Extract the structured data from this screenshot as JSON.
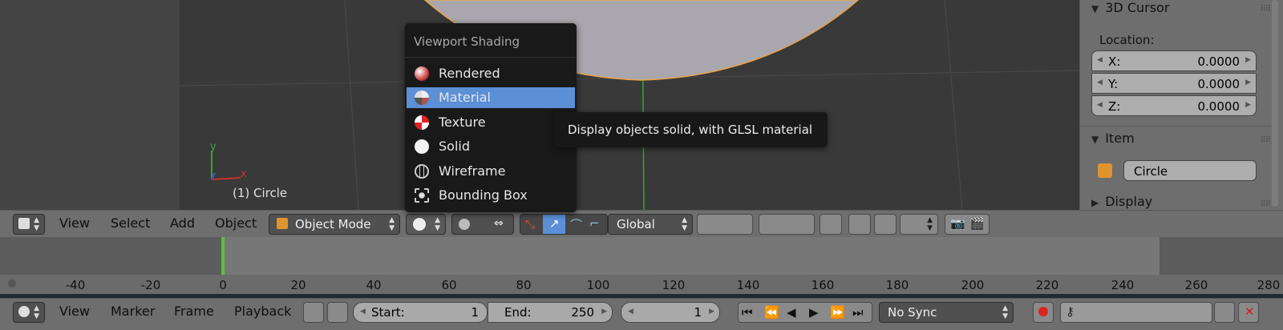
{
  "viewport": {
    "object_label": "(1) Circle",
    "axis_y": "y",
    "axis_x": "x"
  },
  "shading_menu": {
    "title": "Viewport Shading",
    "items": [
      {
        "label": "Rendered",
        "icon": "rendered-sphere-icon"
      },
      {
        "label": "Material",
        "icon": "material-sphere-icon",
        "selected": true
      },
      {
        "label": "Texture",
        "icon": "texture-sphere-icon"
      },
      {
        "label": "Solid",
        "icon": "solid-sphere-icon"
      },
      {
        "label": "Wireframe",
        "icon": "wireframe-sphere-icon"
      },
      {
        "label": "Bounding Box",
        "icon": "bounding-box-icon"
      }
    ],
    "tooltip": "Display objects solid, with GLSL material"
  },
  "properties_panel": {
    "cursor_title": "3D Cursor",
    "location_label": "Location:",
    "fields": [
      {
        "label": "X:",
        "value": "0.0000"
      },
      {
        "label": "Y:",
        "value": "0.0000"
      },
      {
        "label": "Z:",
        "value": "0.0000"
      }
    ],
    "item_title": "Item",
    "item_name": "Circle",
    "display_title": "Display"
  },
  "view3d_header": {
    "menus": [
      "View",
      "Select",
      "Add",
      "Object"
    ],
    "mode": "Object Mode",
    "orientation": "Global"
  },
  "timeline": {
    "ticks": [
      "-40",
      "-20",
      "0",
      "20",
      "40",
      "60",
      "80",
      "100",
      "120",
      "140",
      "160",
      "180",
      "200",
      "220",
      "240",
      "260",
      "280"
    ],
    "current_frame_marker": "0"
  },
  "timeline_header": {
    "menus": [
      "View",
      "Marker",
      "Frame",
      "Playback"
    ],
    "start_label": "Start:",
    "start_value": "1",
    "end_label": "End:",
    "end_value": "250",
    "current_frame": "1",
    "sync": "No Sync"
  },
  "colors": {
    "viewport_bg": "#393939",
    "selection": "#5b8fd6",
    "object_outline": "#e8a34a",
    "current_frame": "#5fbf3a"
  }
}
